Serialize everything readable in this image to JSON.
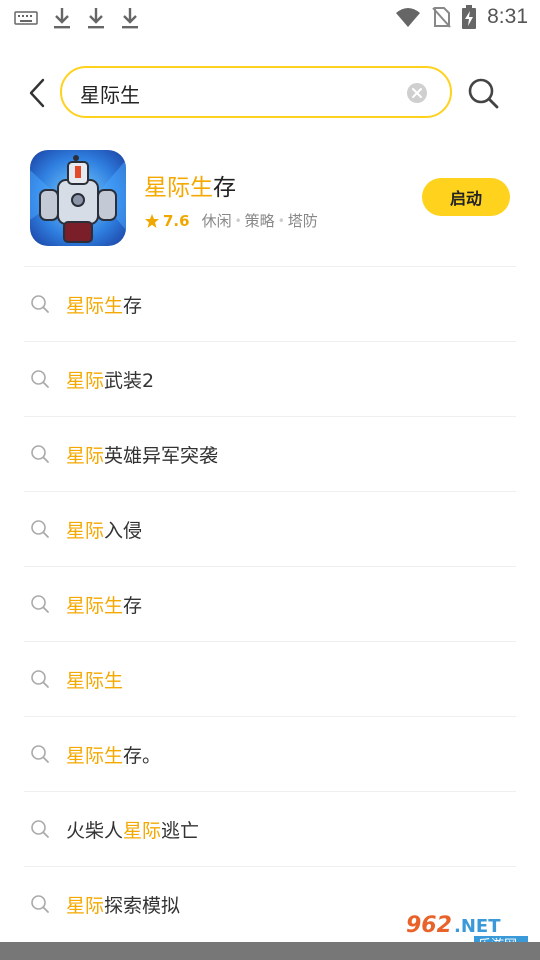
{
  "status_bar": {
    "time": "8:31",
    "left_icons": [
      "keyboard-icon",
      "download-icon",
      "download-icon",
      "download-icon"
    ],
    "right_icons": [
      "wifi-icon",
      "no-sim-icon",
      "battery-charging-icon"
    ]
  },
  "search": {
    "value": "星际生",
    "back_icon": "chevron-left-icon",
    "clear_icon": "clear-circle-icon",
    "search_icon": "search-icon"
  },
  "app_card": {
    "name_highlight": "星际生",
    "name_rest": "存",
    "rating": "7.6",
    "tags": [
      "休闲",
      "策略",
      "塔防"
    ],
    "button_label": "启动"
  },
  "suggestions": [
    {
      "pre": "",
      "hl": "星际生",
      "post": "存"
    },
    {
      "pre": "",
      "hl": "星际",
      "post": "武装2"
    },
    {
      "pre": "",
      "hl": "星际",
      "post": "英雄异军突袭"
    },
    {
      "pre": "",
      "hl": "星际",
      "post": "入侵"
    },
    {
      "pre": "",
      "hl": "星际生",
      "post": "存"
    },
    {
      "pre": "",
      "hl": "星际生",
      "post": ""
    },
    {
      "pre": "",
      "hl": "星际生",
      "post": "存。"
    },
    {
      "pre": "火柴人",
      "hl": "星际",
      "post": "逃亡"
    },
    {
      "pre": "",
      "hl": "星际",
      "post": "探索模拟"
    }
  ],
  "watermark": {
    "number": "962",
    "suffix": ".NET",
    "text": "乐游网"
  },
  "colors": {
    "accent": "#ffd21e",
    "highlight_text": "#f5a800"
  }
}
